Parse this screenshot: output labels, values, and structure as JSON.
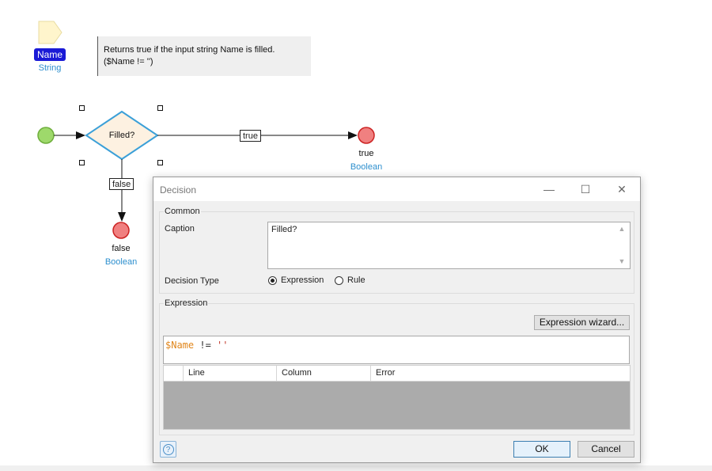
{
  "parameter": {
    "name": "Name",
    "type": "String"
  },
  "annotation": {
    "line1": "Returns true if the input string Name is filled.",
    "line2": "($Name != '')"
  },
  "decision": {
    "label": "Filled?"
  },
  "flows": {
    "true_label": "true",
    "false_label": "false"
  },
  "end_true": {
    "value": "true",
    "type": "Boolean"
  },
  "end_false": {
    "value": "false",
    "type": "Boolean"
  },
  "colors": {
    "param_chip": "#1a1ad6",
    "type_text": "#2d8fce",
    "start_event": "#9ed96b",
    "end_event": "#f08080",
    "decision_fill": "#fdf1e1",
    "decision_stroke": "#3ca0d8"
  },
  "dialog": {
    "title": "Decision",
    "minimize": "—",
    "maximize": "☐",
    "close": "✕",
    "common": {
      "group_title": "Common",
      "caption_label": "Caption",
      "caption_value": "Filled?",
      "decision_type_label": "Decision Type",
      "options": [
        {
          "label": "Expression",
          "selected": true
        },
        {
          "label": "Rule",
          "selected": false
        }
      ]
    },
    "expression": {
      "group_title": "Expression",
      "wizard_button": "Expression wizard...",
      "code_var": "$Name",
      "code_op": " != ",
      "code_str": "''",
      "table_columns": [
        "",
        "Line",
        "Column",
        "Error"
      ]
    },
    "ok_button": "OK",
    "cancel_button": "Cancel",
    "help_icon": "question-mark"
  }
}
